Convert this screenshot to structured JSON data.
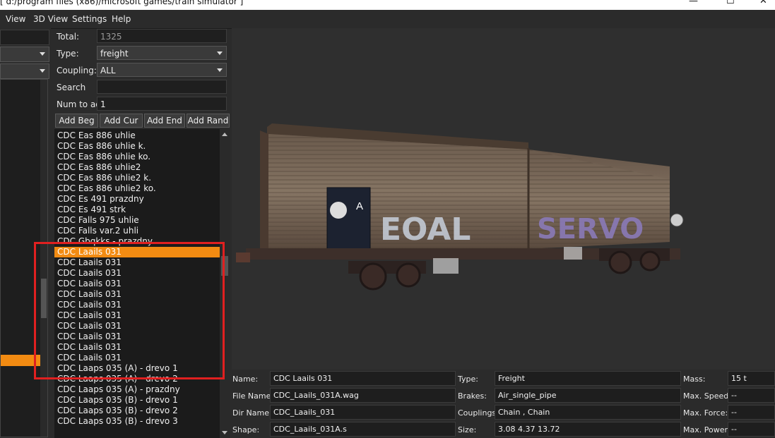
{
  "window": {
    "title": "[ d:/program files (x86)/microsoft games/train simulator ]",
    "minimize_glyph": "—",
    "maximize_glyph": "☐",
    "close_glyph": "✕"
  },
  "menu": {
    "view": "View",
    "view_3d": "3D View",
    "settings": "Settings",
    "help": "Help"
  },
  "filters": {
    "total_label": "Total:",
    "total_value": "1325",
    "type_label": "Type:",
    "type_value": "freight",
    "coupling_label": "Coupling:",
    "coupling_value": "ALL",
    "search_label": "Search",
    "search_value": "",
    "num_label": "Num to add",
    "num_value": "1"
  },
  "buttons": {
    "add_beg": "Add Beg",
    "add_cur": "Add Cur",
    "add_end": "Add End",
    "add_rand": "Add Rand"
  },
  "list": {
    "items": [
      "CDC Eas 886 uhlie",
      "CDC Eas 886 uhlie k.",
      "CDC Eas 886 uhlie ko.",
      "CDC Eas 886 uhlie2",
      "CDC Eas 886 uhlie2 k.",
      "CDC Eas 886 uhlie2 ko.",
      "CDC Es 491 prazdny",
      "CDC Es 491 strk",
      "CDC Falls 975 uhlie",
      "CDC Falls var.2 uhli",
      "CDC Gbqkks - prazdny",
      "CDC Laails 031",
      "CDC Laails 031",
      "CDC Laails 031",
      "CDC Laails 031",
      "CDC Laails 031",
      "CDC Laails 031",
      "CDC Laails 031",
      "CDC Laails 031",
      "CDC Laails 031",
      "CDC Laails 031",
      "CDC Laails 031",
      "CDC Laaps 035 (A) - drevo 1",
      "CDC Laaps 035 (A) - drevo 2",
      "CDC Laaps 035 (A) - prazdny",
      "CDC Laaps 035 (B) - drevo 1",
      "CDC Laaps 035 (B) - drevo 2",
      "CDC Laaps 035 (B) - drevo 3"
    ],
    "selected_index": 11
  },
  "wagon_graphics": {
    "placard_letter": "A",
    "graffiti_left": "EOAL",
    "graffiti_right": "SERVO"
  },
  "info": {
    "name_label": "Name:",
    "name_value": "CDC Laails 031",
    "file_label": "File Name:",
    "file_value": "CDC_Laails_031A.wag",
    "dir_label": "Dir Name:",
    "dir_value": "CDC_Laails_031",
    "shape_label": "Shape:",
    "shape_value": "CDC_Laails_031A.s",
    "type_label": "Type:",
    "type_value": "Freight",
    "brakes_label": "Brakes:",
    "brakes_value": "Air_single_pipe",
    "couplings_label": "Couplings:",
    "couplings_value": "Chain , Chain",
    "size_label": "Size:",
    "size_value": "3.08 4.37 13.72",
    "mass_label": "Mass:",
    "mass_value": "15 t",
    "speed_label": "Max. Speed:",
    "speed_value": "--",
    "force_label": "Max. Force:",
    "force_value": "--",
    "power_label": "Max. Power:",
    "power_value": "--"
  },
  "colors": {
    "selection": "#f28b12",
    "annotation_box": "#e02020",
    "background": "#2b2b2b"
  }
}
